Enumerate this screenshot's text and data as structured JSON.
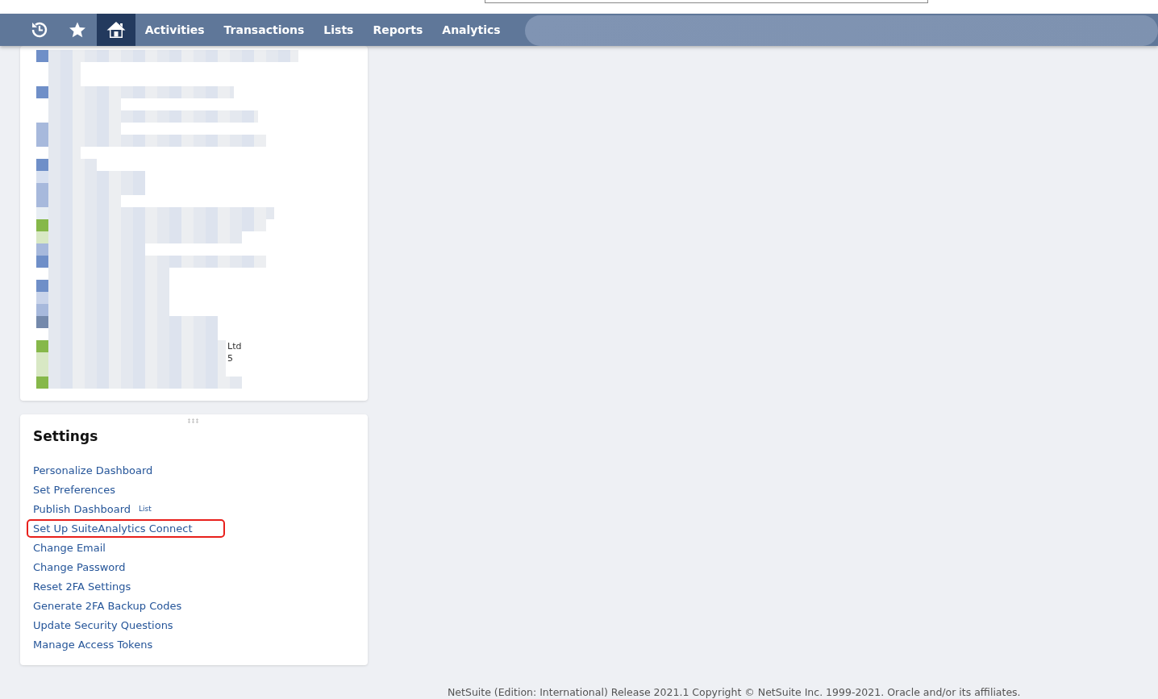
{
  "nav": {
    "icons": [
      {
        "kind": "recent",
        "selected": false
      },
      {
        "kind": "favorites",
        "selected": false
      },
      {
        "kind": "home",
        "selected": true
      }
    ],
    "menu": [
      {
        "label": "Activities"
      },
      {
        "label": "Transactions"
      },
      {
        "label": "Lists"
      },
      {
        "label": "Reports"
      },
      {
        "label": "Analytics"
      }
    ]
  },
  "redacted_list": {
    "rows": [
      {
        "color": "#6f8fc8"
      },
      {},
      {},
      {
        "color": "#6f8fc8"
      },
      {},
      {},
      {
        "color": "#a7b9dc"
      },
      {
        "color": "#a7b9dc"
      },
      {},
      {
        "color": "#6f8fc8"
      },
      {
        "color": "#d7e0f0"
      },
      {
        "color": "#a7b9dc"
      },
      {
        "color": "#a7b9dc"
      },
      {
        "color": "#e8eef3"
      },
      {
        "color": "#86b84a"
      },
      {
        "color": "#d8e8c4"
      },
      {
        "color": "#a7b9dc"
      },
      {
        "color": "#6f8fc8"
      },
      {},
      {
        "color": "#6f8fc8"
      },
      {
        "color": "#c9d4ea"
      },
      {
        "color": "#a7b9dc"
      },
      {
        "color": "#7489ab"
      },
      {},
      {
        "color": "#86b84a",
        "tail": "Ltd"
      },
      {
        "color": "#d8e8c4",
        "tail": "5"
      },
      {
        "color": "#d8e8c4"
      },
      {
        "color": "#86b84a"
      }
    ]
  },
  "settings": {
    "title": "Settings",
    "links": [
      {
        "label": "Personalize Dashboard",
        "highlighted": false
      },
      {
        "label": "Set Preferences",
        "highlighted": false
      },
      {
        "label": "Publish Dashboard",
        "tag": "List",
        "highlighted": false
      },
      {
        "label": "Set Up SuiteAnalytics Connect",
        "highlighted": true
      },
      {
        "label": "Change Email",
        "highlighted": false
      },
      {
        "label": "Change Password",
        "highlighted": false
      },
      {
        "label": "Reset 2FA Settings",
        "highlighted": false
      },
      {
        "label": "Generate 2FA Backup Codes",
        "highlighted": false
      },
      {
        "label": "Update Security Questions",
        "highlighted": false
      },
      {
        "label": "Manage Access Tokens",
        "highlighted": false
      }
    ]
  },
  "footer": "NetSuite (Edition: International) Release 2021.1 Copyright © NetSuite Inc. 1999-2021. Oracle and/or its affiliates."
}
